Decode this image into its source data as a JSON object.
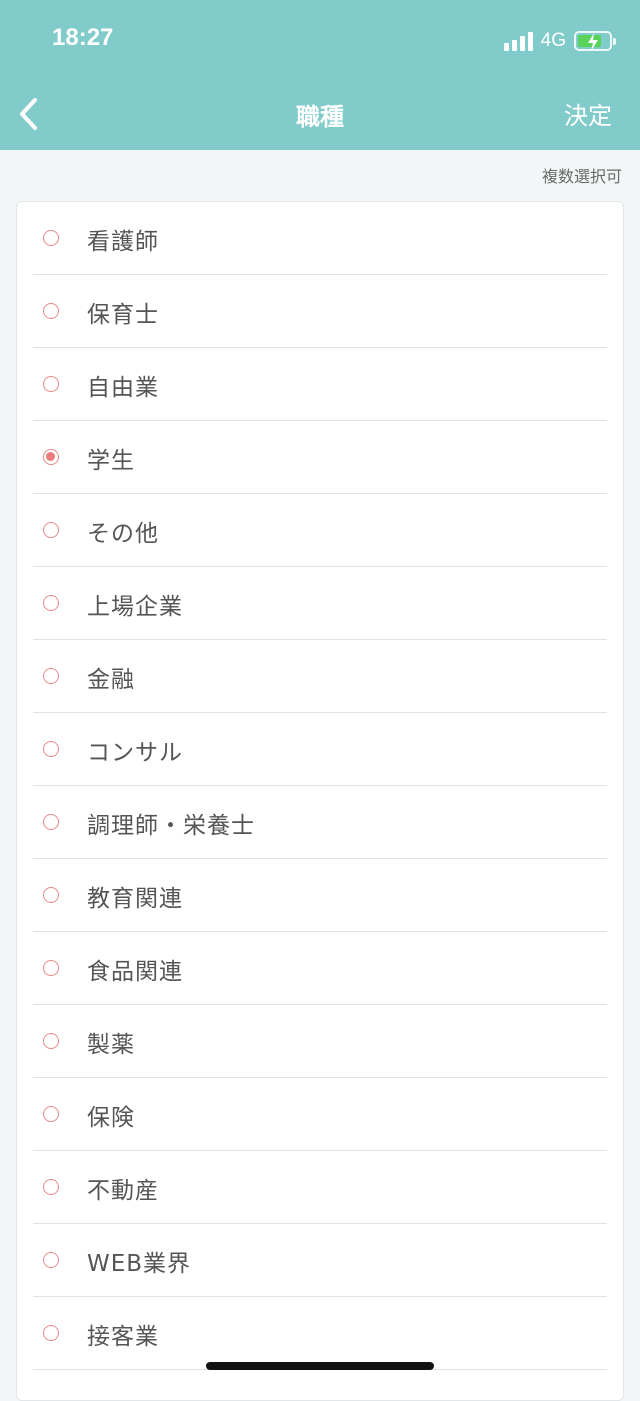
{
  "status_bar": {
    "time": "18:27",
    "network": "4G",
    "battery_level": 0.75
  },
  "nav": {
    "back_icon": "chevron-left-icon",
    "title": "職種",
    "action": "決定"
  },
  "hint": "複数選択可",
  "options": [
    {
      "label": "看護師",
      "checked": false
    },
    {
      "label": "保育士",
      "checked": false
    },
    {
      "label": "自由業",
      "checked": false
    },
    {
      "label": "学生",
      "checked": true
    },
    {
      "label": "その他",
      "checked": false
    },
    {
      "label": "上場企業",
      "checked": false
    },
    {
      "label": "金融",
      "checked": false
    },
    {
      "label": "コンサル",
      "checked": false
    },
    {
      "label": "調理師・栄養士",
      "checked": false
    },
    {
      "label": "教育関連",
      "checked": false
    },
    {
      "label": "食品関連",
      "checked": false
    },
    {
      "label": "製薬",
      "checked": false
    },
    {
      "label": "保険",
      "checked": false
    },
    {
      "label": "不動産",
      "checked": false
    },
    {
      "label": "WEB業界",
      "checked": false
    },
    {
      "label": "接客業",
      "checked": false
    }
  ],
  "colors": {
    "header": "#82cbcb",
    "radio": "#ec7b7b",
    "battery": "#5ad35a"
  }
}
